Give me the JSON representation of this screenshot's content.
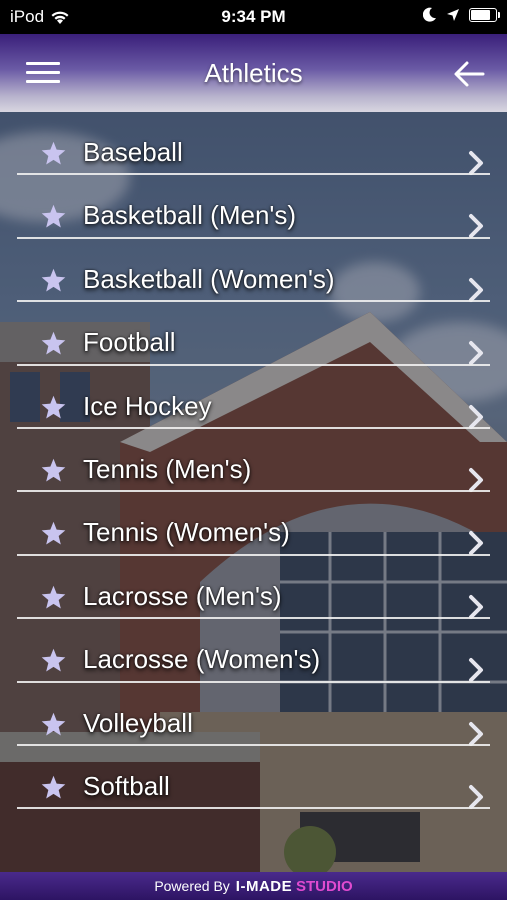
{
  "status_bar": {
    "carrier": "iPod",
    "time": "9:34 PM",
    "battery_level": 0.85
  },
  "header": {
    "title": "Athletics",
    "menu_icon": "hamburger-menu-icon",
    "back_icon": "arrow-left-icon",
    "gradient_top": "#3a1f7a"
  },
  "sports": [
    "Baseball",
    "Basketball (Men's)",
    "Basketball (Women's)",
    "Football",
    "Ice Hockey",
    "Tennis (Men's)",
    "Tennis (Women's)",
    "Lacrosse (Men's)",
    "Lacrosse (Women's)",
    "Volleyball",
    "Softball"
  ],
  "list_icons": {
    "leading": "star-icon",
    "trailing": "chevron-right-icon",
    "star_color": "#c9c4ef"
  },
  "footer": {
    "powered_by": "Powered By",
    "brand": "I-MADE",
    "brand_accent": "STUDIO",
    "accent_color": "#e04bd0"
  }
}
